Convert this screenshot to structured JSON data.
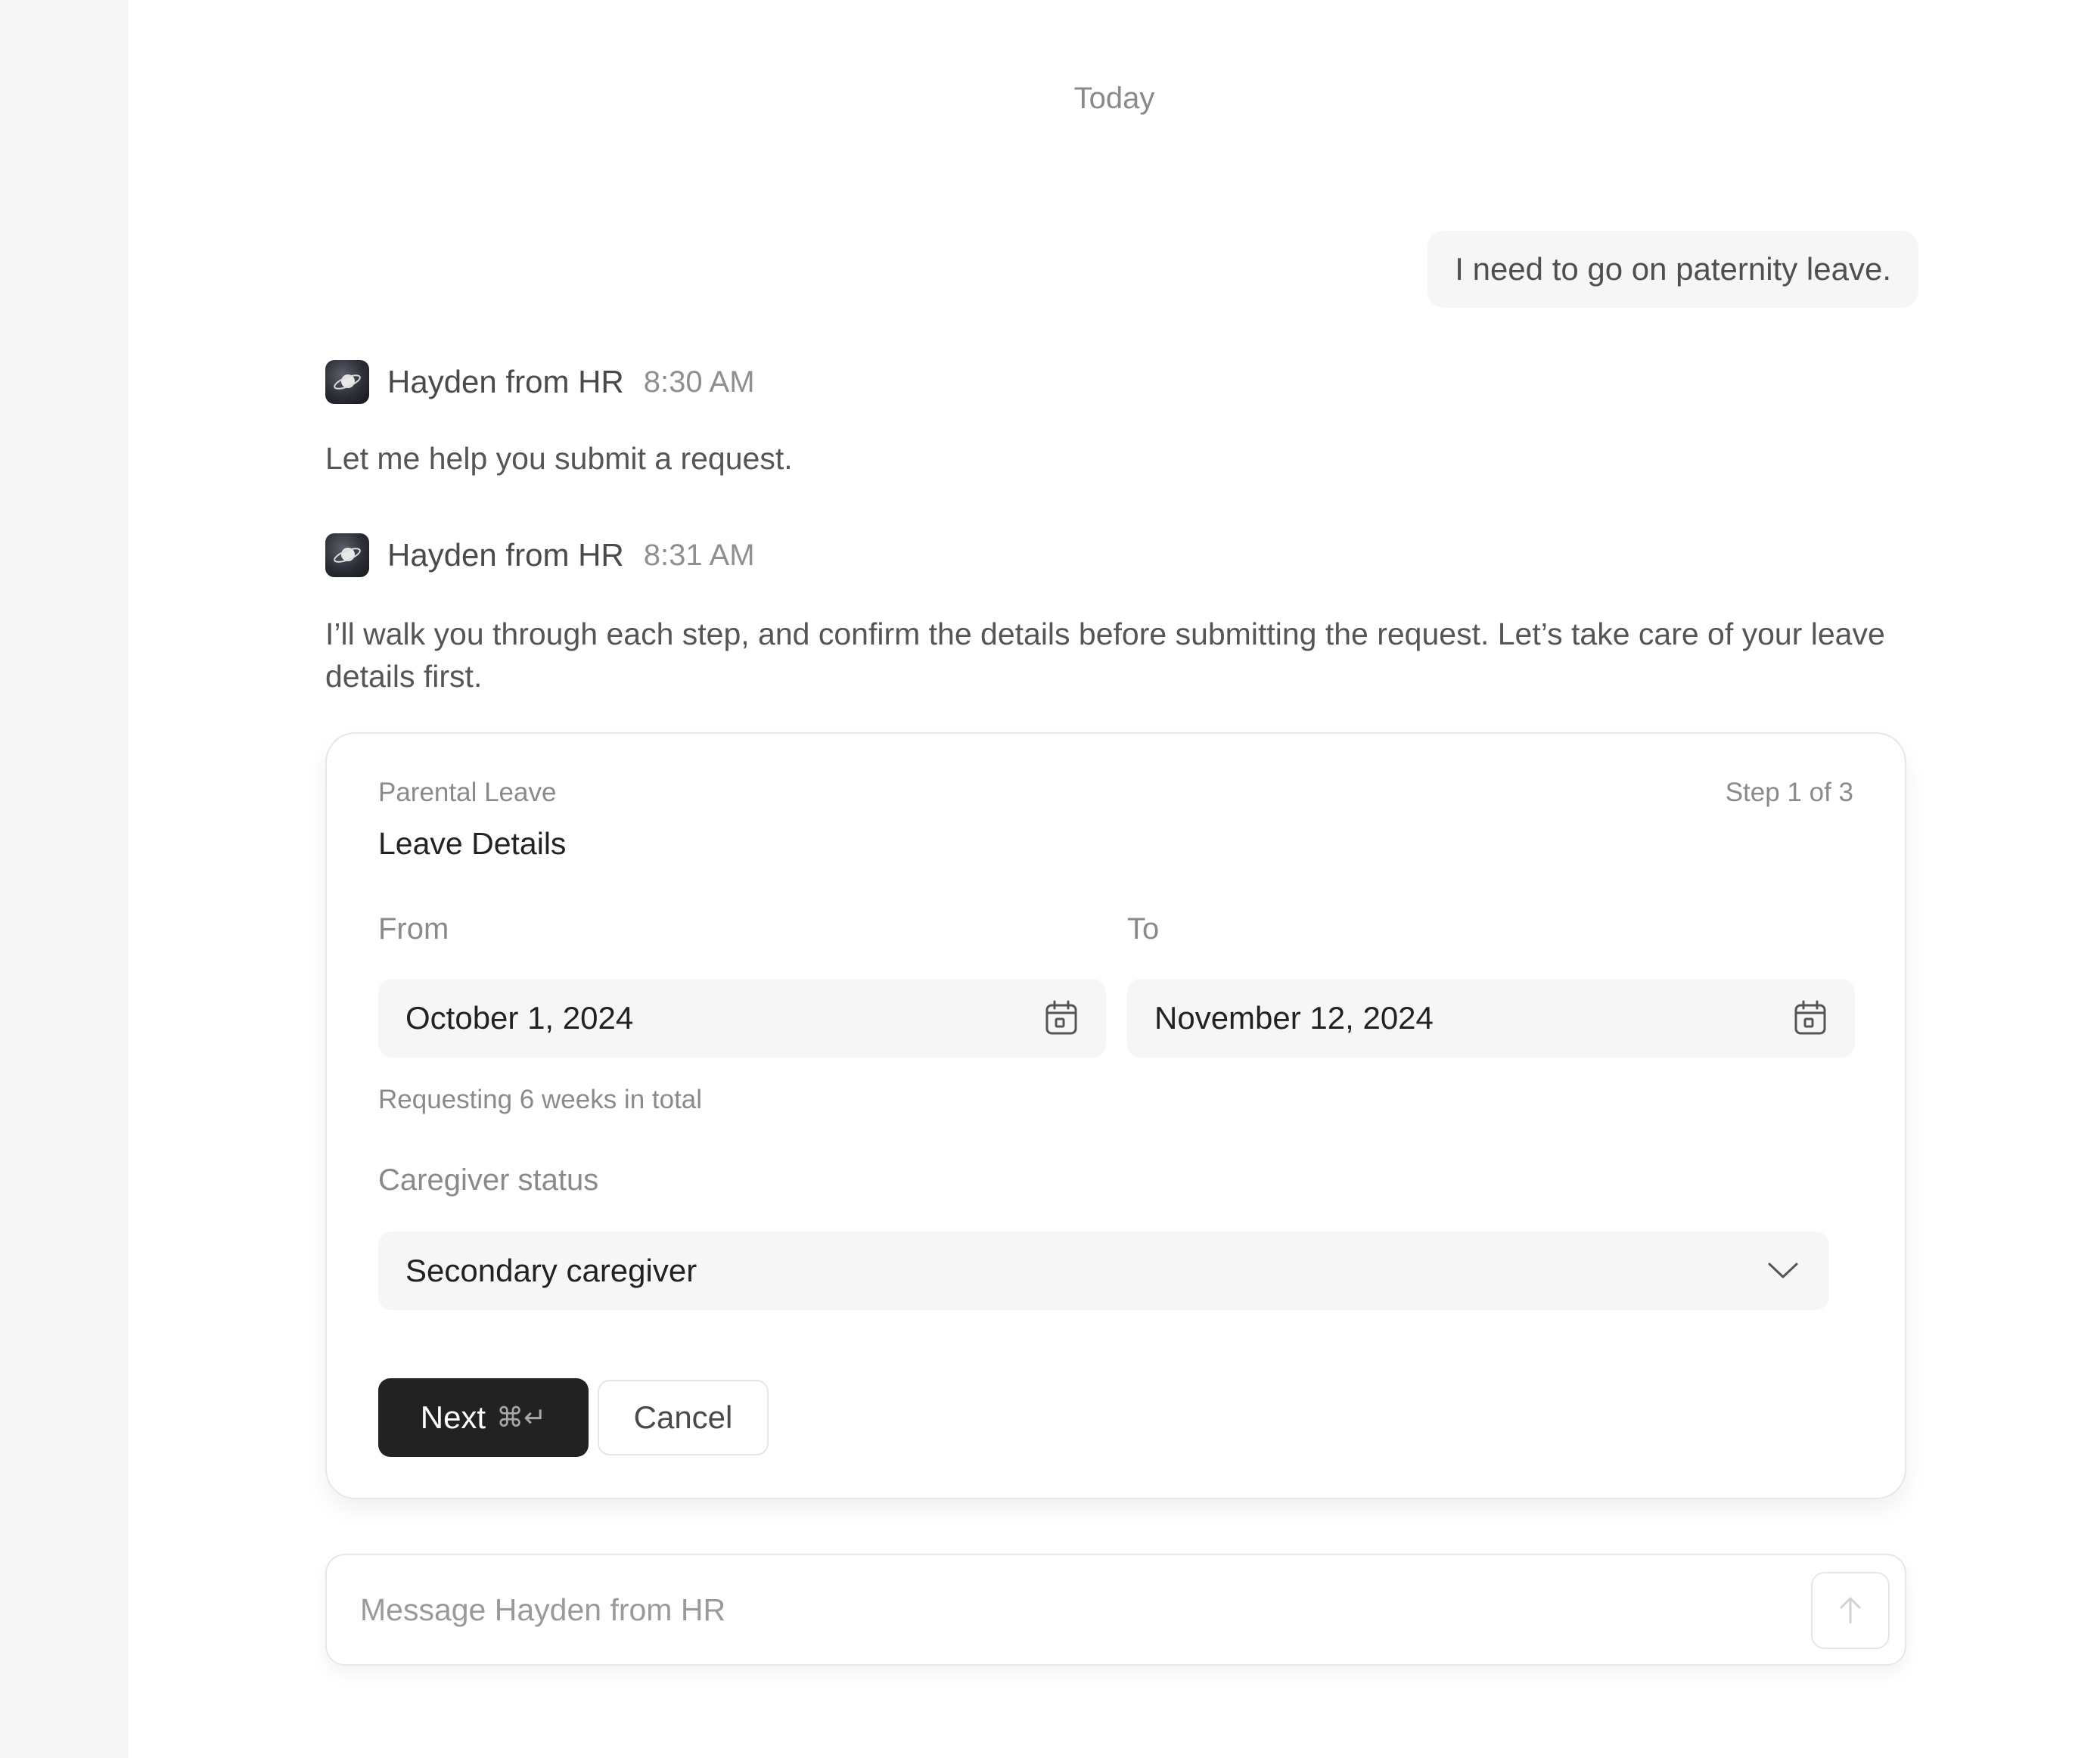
{
  "chat": {
    "date_divider": "Today",
    "user_message": "I need to go on paternity leave.",
    "messages": [
      {
        "sender": "Hayden from HR",
        "time": "8:30 AM",
        "text": "Let me help you submit a request."
      },
      {
        "sender": "Hayden from HR",
        "time": "8:31 AM",
        "text": "I’ll walk you through each step, and confirm the details before submitting the request. Let’s take care of your leave details first."
      }
    ]
  },
  "form": {
    "eyebrow": "Parental Leave",
    "step": "Step 1 of 3",
    "title": "Leave Details",
    "from_label": "From",
    "from_value": "October 1, 2024",
    "to_label": "To",
    "to_value": "November 12, 2024",
    "helper": "Requesting 6 weeks in total",
    "caregiver_label": "Caregiver status",
    "caregiver_value": "Secondary caregiver",
    "next_label": "Next",
    "next_shortcut": "⌘↵",
    "cancel_label": "Cancel"
  },
  "composer": {
    "placeholder": "Message Hayden from HR"
  },
  "icons": {
    "avatar": "planet-icon",
    "date": "calendar-icon",
    "select": "chevron-down-icon",
    "send": "arrow-up-icon"
  },
  "colors": {
    "primary_button": "#222222",
    "sidebar": "#f6f6f6",
    "input_bg": "#f6f6f6"
  }
}
